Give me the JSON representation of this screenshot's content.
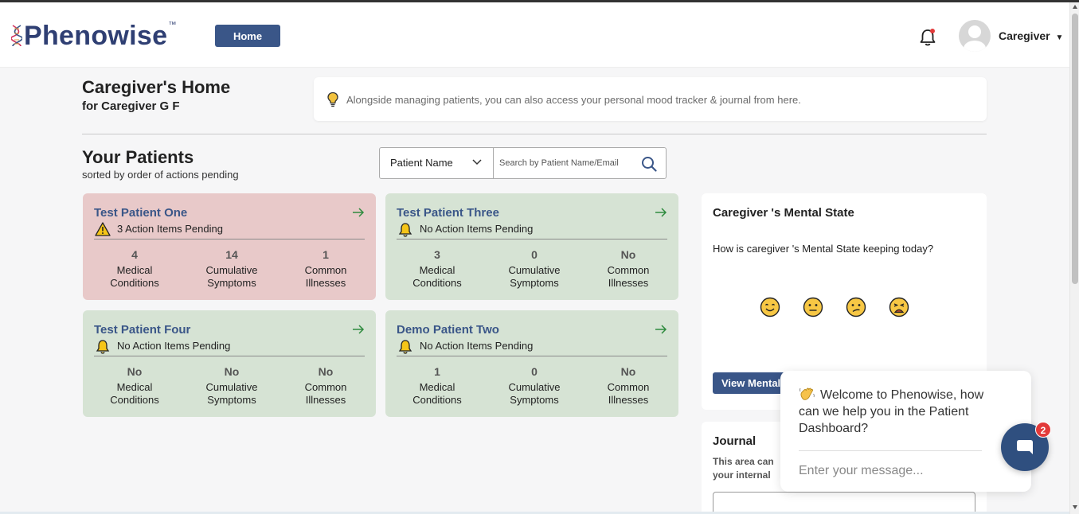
{
  "header": {
    "logo_text": "Phenowise",
    "logo_tm": "™",
    "home_label": "Home",
    "notification_dot_color": "#e23a3a",
    "user_name": "Caregiver",
    "user_menu_icon": "caret-down-icon"
  },
  "page": {
    "title": "Caregiver's Home",
    "subtitle": "for Caregiver G F",
    "info_icon": "lightbulb-icon",
    "info_text": "Alongside managing patients, you can also access your personal mood tracker & journal from here."
  },
  "patients_section": {
    "title": "Your Patients",
    "subtitle": "sorted by order of actions pending",
    "search_filter_value": "Patient Name",
    "search_placeholder": "Search by Patient Name/Email"
  },
  "patients": [
    {
      "name": "Test Patient One",
      "status": "3 Action Items Pending",
      "status_icon": "warning-icon",
      "color": "#e8c9c9",
      "stats": [
        {
          "value": "4",
          "label_1": "Medical",
          "label_2": "Conditions"
        },
        {
          "value": "14",
          "label_1": "Cumulative",
          "label_2": "Symptoms"
        },
        {
          "value": "1",
          "label_1": "Common",
          "label_2": "Illnesses"
        }
      ]
    },
    {
      "name": "Test Patient Three",
      "status": "No Action Items Pending",
      "status_icon": "bell-icon",
      "color": "#d6e3d4",
      "stats": [
        {
          "value": "3",
          "label_1": "Medical",
          "label_2": "Conditions"
        },
        {
          "value": "0",
          "label_1": "Cumulative",
          "label_2": "Symptoms"
        },
        {
          "value": "No",
          "label_1": "Common",
          "label_2": "Illnesses"
        }
      ]
    },
    {
      "name": "Test Patient Four",
      "status": "No Action Items Pending",
      "status_icon": "bell-icon",
      "color": "#d6e3d4",
      "stats": [
        {
          "value": "No",
          "label_1": "Medical",
          "label_2": "Conditions"
        },
        {
          "value": "No",
          "label_1": "Cumulative",
          "label_2": "Symptoms"
        },
        {
          "value": "No",
          "label_1": "Common",
          "label_2": "Illnesses"
        }
      ]
    },
    {
      "name": "Demo Patient Two",
      "status": "No Action Items Pending",
      "status_icon": "bell-icon",
      "color": "#d6e3d4",
      "stats": [
        {
          "value": "1",
          "label_1": "Medical",
          "label_2": "Conditions"
        },
        {
          "value": "0",
          "label_1": "Cumulative",
          "label_2": "Symptoms"
        },
        {
          "value": "No",
          "label_1": "Common",
          "label_2": "Illnesses"
        }
      ]
    }
  ],
  "mental_state": {
    "title": "Caregiver 's Mental State",
    "question": "How is caregiver 's Mental State keeping today?",
    "moods": [
      "smiling-face-icon",
      "neutral-face-icon",
      "confused-face-icon",
      "distressed-face-icon"
    ],
    "button_label": "View Mental"
  },
  "journal": {
    "title": "Journal",
    "description": "This area can your internal"
  },
  "chat": {
    "message": "Welcome to Phenowise, how can we help you in the Patient Dashboard?",
    "wave_icon": "waving-hand-icon",
    "input_placeholder": "Enter your message...",
    "badge_count": "2",
    "accent": "#2f4f7f"
  },
  "colors": {
    "brand": "#3a5688",
    "logo": "#2f3f73"
  }
}
